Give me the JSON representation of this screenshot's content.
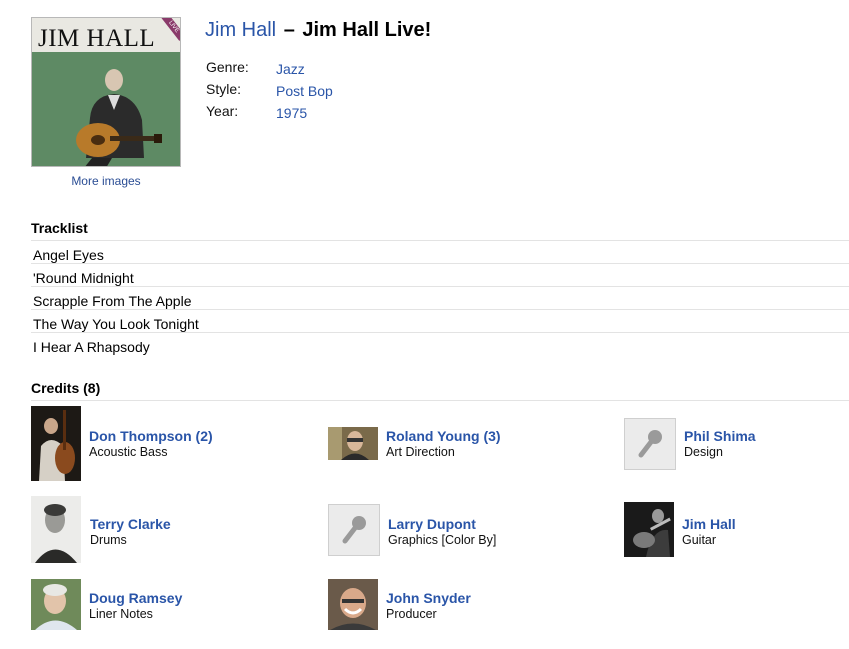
{
  "release": {
    "artist": "Jim Hall",
    "separator": "–",
    "title": "Jim Hall Live!",
    "cover_artist_text": "JIM HALL",
    "cover_badge_text": "LIVE",
    "more_images": "More images",
    "genre_label": "Genre:",
    "genre": "Jazz",
    "style_label": "Style:",
    "style": "Post Bop",
    "year_label": "Year:",
    "year": "1975"
  },
  "tracklist": {
    "heading": "Tracklist",
    "tracks": [
      "Angel Eyes",
      "'Round Midnight",
      "Scrapple From The Apple",
      "The Way You Look Tonight",
      "I Hear A Rhapsody"
    ]
  },
  "credits": {
    "heading": "Credits (8)",
    "people": [
      {
        "name": "Don Thompson (2)",
        "role": "Acoustic Bass",
        "thumb": "photo-bass"
      },
      {
        "name": "Roland Young (3)",
        "role": "Art Direction",
        "thumb": "photo-glasses"
      },
      {
        "name": "Phil Shima",
        "role": "Design",
        "thumb": "microphone-placeholder-icon"
      },
      {
        "name": "Terry Clarke",
        "role": "Drums",
        "thumb": "photo-bw-portrait"
      },
      {
        "name": "Larry Dupont",
        "role": "Graphics [Color By]",
        "thumb": "microphone-placeholder-icon"
      },
      {
        "name": "Jim Hall",
        "role": "Guitar",
        "thumb": "photo-guitar"
      },
      {
        "name": "Doug Ramsey",
        "role": "Liner Notes",
        "thumb": "photo-portrait"
      },
      {
        "name": "John Snyder",
        "role": "Producer",
        "thumb": "photo-smiling"
      }
    ]
  },
  "colors": {
    "link": "#2a55a8",
    "cover_green": "#5e8a64",
    "badge": "#8a3a6a"
  }
}
